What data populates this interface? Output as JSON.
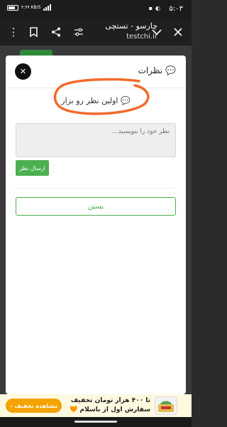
{
  "status_bar": {
    "time": "۵:۰۳",
    "network_speed": "۴,۹۹ KB/S"
  },
  "browser": {
    "title": "چارسو - تستچی",
    "url": "testchi.ir"
  },
  "modal": {
    "title": "نظرات",
    "first_comment_prompt": "اولین نظر رو بزار",
    "textarea_placeholder": "نظر خود را بنویسید...",
    "submit_label": "ارسال نظر",
    "close_label": "بستن",
    "close_x": "✕"
  },
  "ad_banner": {
    "line1": "تا ۴۰۰ هزار تومان تخفیف",
    "line2": "سفارش اول از باسلام 🧡",
    "button_label": "مشاهده تخفیف"
  },
  "colors": {
    "accent_green": "#4caf50",
    "scribble_orange": "#f36a2b",
    "ad_orange": "#f5a300"
  }
}
